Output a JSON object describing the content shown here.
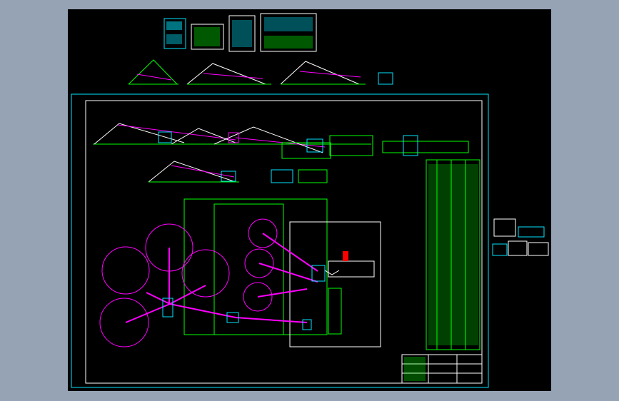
{
  "drawing": {
    "view_background": "#96a3b5",
    "paper_background": "#000000",
    "colors": {
      "frame": "#00e5ff",
      "linework": "#00ff00",
      "pipes": "#ff00ff",
      "tanks": "#ff00ff",
      "equipment": "#00e5ff",
      "highlight": "#ff0000"
    },
    "layers": [
      "detail-views",
      "elevation-views",
      "main-plan",
      "parts-table",
      "title-block",
      "side-details"
    ]
  }
}
